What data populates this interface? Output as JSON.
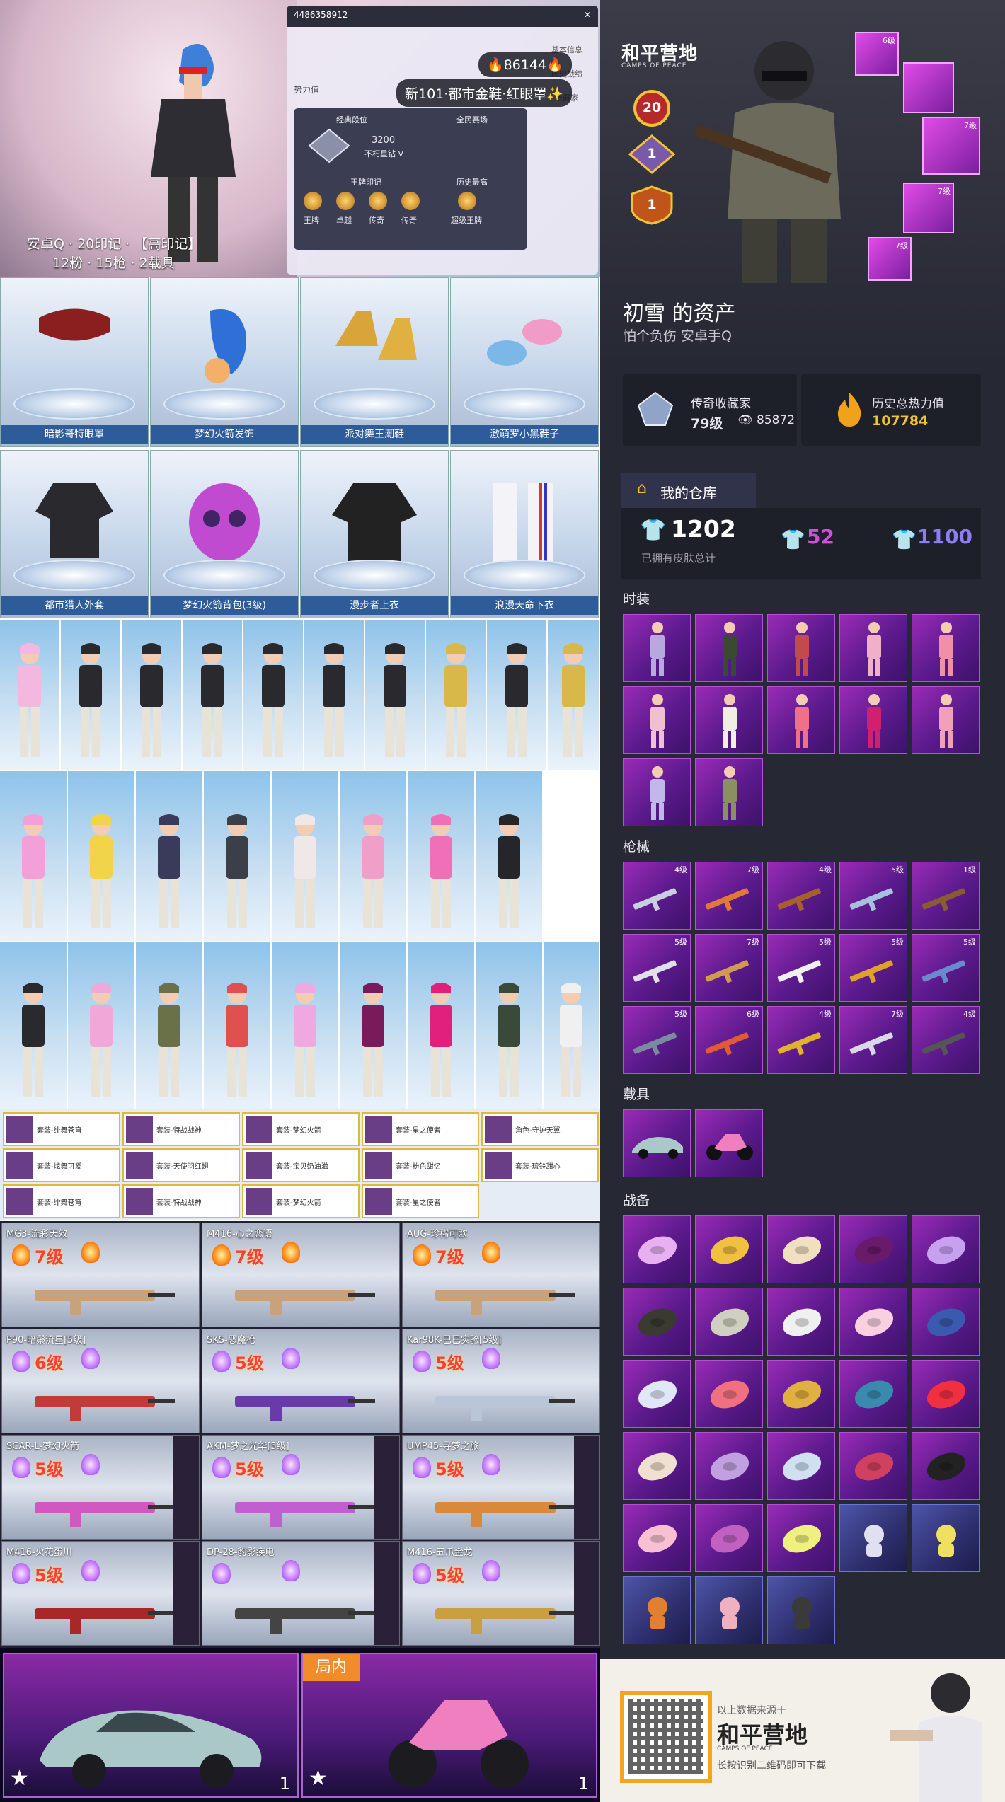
{
  "top": {
    "overlay_line1": "安卓Q · 20印记 · 【高印记】",
    "overlay_line2": "12粉 · 15枪 · 2载具",
    "profile_id": "4486358912",
    "power_label": "势力值",
    "panel_tabs": [
      "基本信息",
      "历史战绩",
      "收藏家"
    ],
    "rank_title": "经典段位",
    "rank_score": "3200",
    "rank_name": "不朽星钻 V",
    "rank_title2": "全民赛场",
    "ace_title": "王牌印记",
    "ace_labels": [
      "王牌",
      "卓越",
      "传奇",
      "传奇",
      "传奇"
    ],
    "history_title": "历史最高",
    "history_sub": "超级王牌",
    "heat_pill": "86144",
    "outfit_pill": "新101·都市金鞋·红眼罩✨"
  },
  "items_row1": [
    {
      "name": "暗影哥特眼罩"
    },
    {
      "name": "梦幻火箭发饰"
    },
    {
      "name": "派对舞王潮鞋"
    },
    {
      "name": "激萌罗小黑鞋子"
    }
  ],
  "items_row2": [
    {
      "name": "都市猎人外套"
    },
    {
      "name": "梦幻火箭背包(3级)"
    },
    {
      "name": "漫步者上衣"
    },
    {
      "name": "浪漫天命下衣"
    }
  ],
  "outfit_list": [
    "套装-绯舞苍穹",
    "套装-特战战神",
    "套装-梦幻火箭",
    "套装-星之使者",
    "角色-守护天翼",
    "套装-炫舞可爱",
    "套装-天使羽红翅",
    "套装-宝贝奶油滋",
    "套装-粉色甜忆",
    "套装-琉铃甜心",
    "套装-绯舞苍穹",
    "套装-特战战神",
    "套装-梦幻火箭",
    "套装-星之使者"
  ],
  "guns_left": [
    {
      "name": "MG3-流彩天效",
      "level": "7级",
      "flame": "orange"
    },
    {
      "name": "M416-心之恋语",
      "level": "7级",
      "flame": "orange"
    },
    {
      "name": "AUG-珍稀可欧",
      "level": "7级",
      "flame": "orange"
    },
    {
      "name": "P90-暗鬃流星[5级]",
      "level": "6级",
      "flame": "purple"
    },
    {
      "name": "SKS-恶魔枪",
      "level": "5级",
      "flame": "purple"
    },
    {
      "name": "Kar98K-巴巴实验[5级]",
      "level": "5级",
      "flame": "purple"
    },
    {
      "name": "SCAR-L-梦幻火箭",
      "level": "5级",
      "flame": "purple"
    },
    {
      "name": "AKM-梦之光华[5级]",
      "level": "5级",
      "flame": "purple"
    },
    {
      "name": "UMP45-寻梦之旅",
      "level": "5级",
      "flame": "purple"
    },
    {
      "name": "M416-火花蛋川",
      "level": "5级",
      "flame": "purple"
    },
    {
      "name": "DP-28-豹影疾电",
      "level": "",
      "flame": "purple"
    },
    {
      "name": "M416-五爪金龙",
      "level": "5级",
      "flame": "purple"
    }
  ],
  "vehicles_left": {
    "tag": "局内",
    "count_a": "1",
    "count_b": "1",
    "star": "★"
  },
  "right": {
    "brand": "和平营地",
    "brand_sub": "CAMPS OF PEACE",
    "badges": [
      "20",
      "1",
      "1"
    ],
    "hero_skins": [
      {
        "lv": "6级"
      },
      {
        "lv": ""
      },
      {
        "lv": "7级"
      },
      {
        "lv": "7级"
      },
      {
        "lv": "7级"
      }
    ],
    "owner_name": "初雪 的资产",
    "owner_sub": "怕个负伤   安卓手Q",
    "collector_label": "传奇收藏家",
    "collector_level": "79级",
    "collector_points": "85872",
    "heat_label": "历史总热力值",
    "heat_value": "107784",
    "warehouse_title": "我的仓库",
    "skins_total": "1202",
    "skins_total_label": "已拥有皮肤总计",
    "purple_count": "52",
    "blue_count": "1100",
    "sec_fashion": "时装",
    "sec_guns": "枪械",
    "sec_vehicles": "载具",
    "sec_gear": "战备",
    "gun_levels": [
      "4级",
      "7级",
      "4级",
      "5级",
      "1级",
      "5级",
      "7级",
      "5级",
      "5级",
      "5级",
      "5级",
      "6级",
      "4级",
      "7级",
      "4级"
    ],
    "footer_line1": "以上数据来源于",
    "footer_logo": "和平营地",
    "footer_logo_sub": "CAMPS OF PEACE",
    "footer_line2": "长按识别二维码即可下载"
  },
  "colors": {
    "panel_bg": "#262834",
    "tile_purple": "#9a2bb7",
    "gold": "#f1c232",
    "accent_orange": "#f08c2a"
  }
}
